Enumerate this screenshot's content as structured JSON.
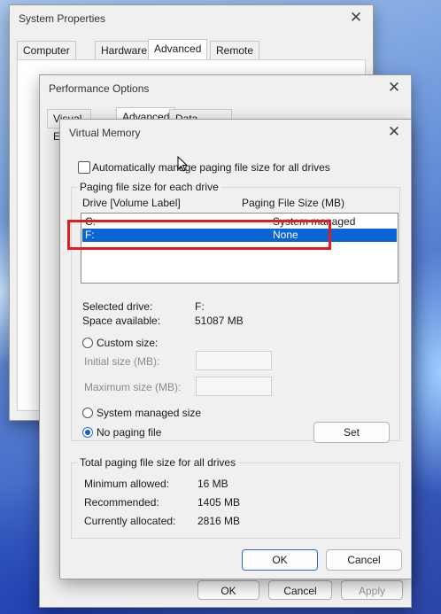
{
  "system_properties": {
    "title": "System Properties",
    "tabs": [
      "Computer Name",
      "Hardware",
      "Advanced",
      "Remote"
    ],
    "bottom_buttons": {
      "ok": "OK",
      "cancel": "Cancel",
      "apply": "Apply"
    }
  },
  "performance_options": {
    "title": "Performance Options",
    "tabs": [
      "Visual Effects",
      "Advanced",
      "Data Execution Prevention"
    ]
  },
  "virtual_memory": {
    "title": "Virtual Memory",
    "auto_manage_label": "Automatically manage paging file size for all drives",
    "auto_manage_checked": false,
    "group_title": "Paging file size for each drive",
    "columns": {
      "drive": "Drive  [Volume Label]",
      "size": "Paging File Size (MB)"
    },
    "drives": [
      {
        "drive": "C:",
        "size": "System managed",
        "selected": false
      },
      {
        "drive": "F:",
        "size": "None",
        "selected": true
      }
    ],
    "selected_drive_label": "Selected drive:",
    "selected_drive_value": "F:",
    "space_available_label": "Space available:",
    "space_available_value": "51087 MB",
    "custom_size_label": "Custom size:",
    "initial_size_label": "Initial size (MB):",
    "maximum_size_label": "Maximum size (MB):",
    "system_managed_label": "System managed size",
    "no_paging_label": "No paging file",
    "selected_option": "no_paging",
    "set_button": "Set",
    "totals_title": "Total paging file size for all drives",
    "minimum_label": "Minimum allowed:",
    "minimum_value": "16 MB",
    "recommended_label": "Recommended:",
    "recommended_value": "1405 MB",
    "allocated_label": "Currently allocated:",
    "allocated_value": "2816 MB",
    "ok_button": "OK",
    "cancel_button": "Cancel"
  },
  "colors": {
    "selection": "#0a64d6",
    "annotation_box": "#e01e1e",
    "primary_border": "#2a6fd0"
  }
}
